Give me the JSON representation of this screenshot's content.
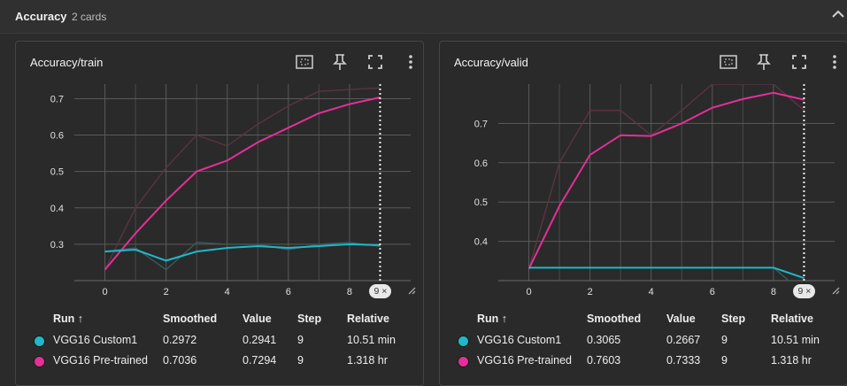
{
  "group": {
    "title": "Accuracy",
    "count": "2 cards",
    "collapse_icon": "chevron-up-icon"
  },
  "toolbar_icons": [
    "fit-domain-icon",
    "pin-icon",
    "fullscreen-icon",
    "more-vert-icon"
  ],
  "legend_headers": {
    "run": "Run ↑",
    "smoothed": "Smoothed",
    "value": "Value",
    "step": "Step",
    "relative": "Relative"
  },
  "colors": {
    "custom": "#1fb8c8",
    "pretrained": "#e42f98",
    "pretrained_raw": "#5a3440",
    "custom_raw": "#3a5a5e"
  },
  "cards": [
    {
      "title": "Accuracy/train",
      "step_badge": "9 ×",
      "legend": [
        {
          "run": "VGG16 Custom1",
          "smoothed": "0.2972",
          "value": "0.2941",
          "step": "9",
          "relative": "10.51 min"
        },
        {
          "run": "VGG16 Pre-trained",
          "smoothed": "0.7036",
          "value": "0.7294",
          "step": "9",
          "relative": "1.318 hr"
        }
      ]
    },
    {
      "title": "Accuracy/valid",
      "step_badge": "9 ×",
      "legend": [
        {
          "run": "VGG16 Custom1",
          "smoothed": "0.3065",
          "value": "0.2667",
          "step": "9",
          "relative": "10.51 min"
        },
        {
          "run": "VGG16 Pre-trained",
          "smoothed": "0.7603",
          "value": "0.7333",
          "step": "9",
          "relative": "1.318 hr"
        }
      ]
    }
  ],
  "chart_data": [
    {
      "type": "line",
      "title": "Accuracy/train",
      "xlim": [
        -1,
        10
      ],
      "ylim": [
        0.2,
        0.74
      ],
      "x_ticks": [
        "0",
        "2",
        "4",
        "6",
        "8"
      ],
      "y_ticks": [
        "0.3",
        "0.4",
        "0.5",
        "0.6",
        "0.7"
      ],
      "x": [
        0,
        1,
        2,
        3,
        4,
        5,
        6,
        7,
        8,
        9
      ],
      "series": [
        {
          "name": "VGG16 Pre-trained",
          "smoothed": true,
          "values": [
            0.23,
            0.33,
            0.42,
            0.5,
            0.53,
            0.58,
            0.62,
            0.66,
            0.685,
            0.7036
          ]
        },
        {
          "name": "VGG16 Pre-trained",
          "smoothed": false,
          "values": [
            0.23,
            0.4,
            0.51,
            0.6,
            0.57,
            0.63,
            0.68,
            0.72,
            0.725,
            0.7294
          ]
        },
        {
          "name": "VGG16 Custom1",
          "smoothed": true,
          "values": [
            0.28,
            0.285,
            0.255,
            0.28,
            0.29,
            0.295,
            0.29,
            0.295,
            0.3,
            0.2972
          ]
        },
        {
          "name": "VGG16 Custom1",
          "smoothed": false,
          "values": [
            0.28,
            0.29,
            0.23,
            0.305,
            0.3,
            0.3,
            0.285,
            0.3,
            0.305,
            0.2941
          ]
        }
      ]
    },
    {
      "type": "line",
      "title": "Accuracy/valid",
      "xlim": [
        -1,
        10
      ],
      "ylim": [
        0.3,
        0.8
      ],
      "x_ticks": [
        "0",
        "2",
        "4",
        "6",
        "8"
      ],
      "y_ticks": [
        "0.4",
        "0.5",
        "0.6",
        "0.7"
      ],
      "x": [
        0,
        1,
        2,
        3,
        4,
        5,
        6,
        7,
        8,
        9
      ],
      "series": [
        {
          "name": "VGG16 Pre-trained",
          "smoothed": true,
          "values": [
            0.33,
            0.49,
            0.62,
            0.67,
            0.668,
            0.7,
            0.74,
            0.762,
            0.778,
            0.7603
          ]
        },
        {
          "name": "VGG16 Pre-trained",
          "smoothed": false,
          "values": [
            0.33,
            0.6,
            0.733,
            0.733,
            0.67,
            0.733,
            0.8,
            0.8,
            0.8,
            0.7333
          ]
        },
        {
          "name": "VGG16 Custom1",
          "smoothed": true,
          "values": [
            0.333,
            0.333,
            0.333,
            0.333,
            0.333,
            0.333,
            0.333,
            0.333,
            0.333,
            0.3065
          ]
        },
        {
          "name": "VGG16 Custom1",
          "smoothed": false,
          "values": [
            0.333,
            0.333,
            0.333,
            0.333,
            0.333,
            0.333,
            0.333,
            0.333,
            0.333,
            0.2667
          ]
        }
      ]
    }
  ]
}
